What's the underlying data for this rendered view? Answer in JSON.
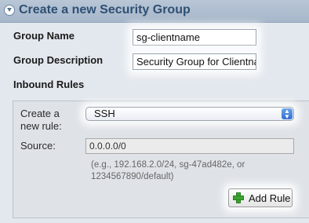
{
  "header": {
    "title": "Create a new Security Group",
    "icon": "collapse-circle-icon"
  },
  "form": {
    "group_name_label": "Group Name",
    "group_name_value": "sg-clientname",
    "group_description_label": "Group Description",
    "group_description_value": "Security Group for Clientna",
    "inbound_rules_label": "Inbound Rules"
  },
  "rules": {
    "create_rule_label_line1": "Create a",
    "create_rule_label_line2": "new rule:",
    "rule_type_selected": "SSH",
    "source_label": "Source:",
    "source_value": "0.0.0.0/0",
    "source_hint_line1": "(e.g., 192.168.2.0/24, sg-47ad482e, or",
    "source_hint_line2": "1234567890/default)",
    "add_rule_label": "Add Rule",
    "add_rule_icon": "plus-icon"
  },
  "colors": {
    "header_text": "#2f4f73",
    "header_bg": "#a6b7ca",
    "page_bg": "#e3e8ee",
    "plus_icon": "#3aa52f"
  }
}
